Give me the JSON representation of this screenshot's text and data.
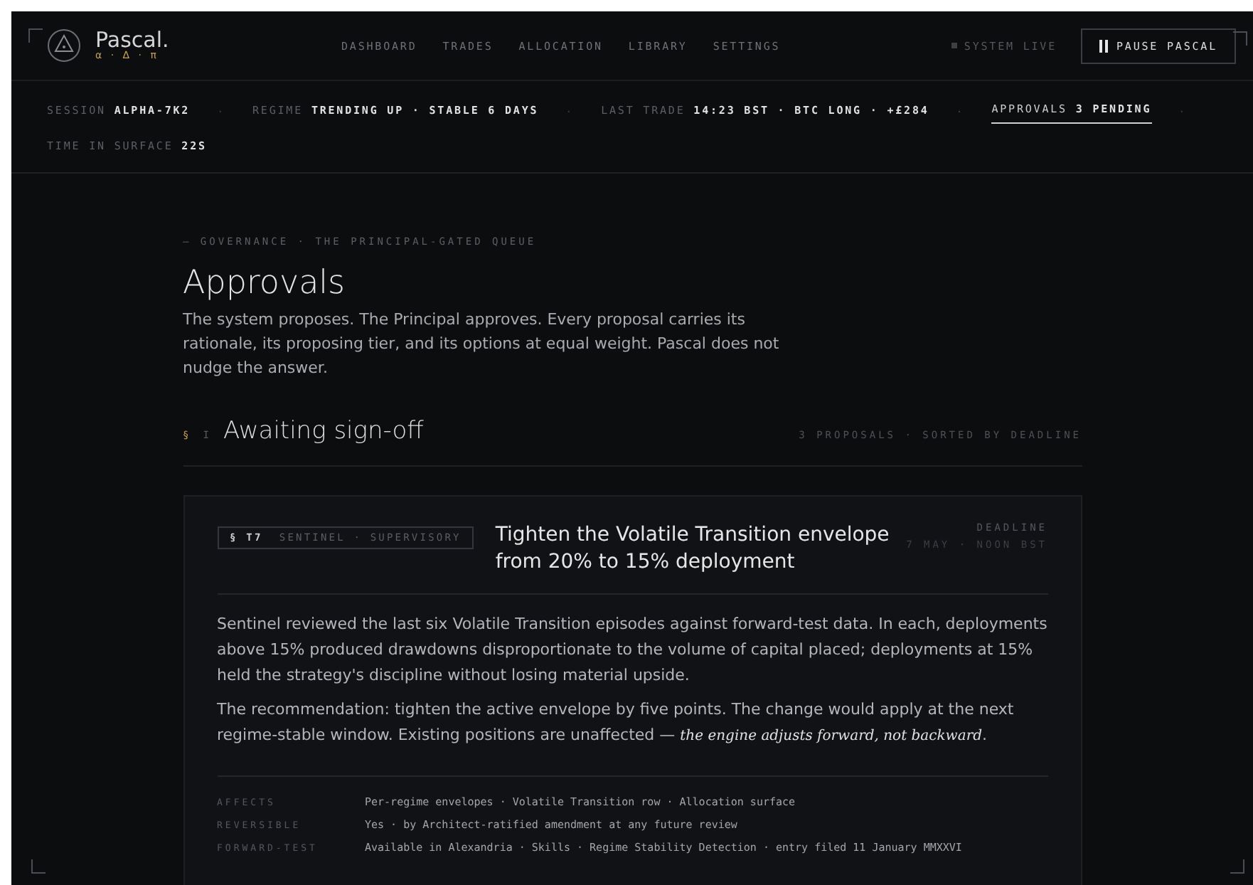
{
  "brand": {
    "name": "Pascal.",
    "subtitle": "α · Δ · π"
  },
  "nav": [
    "DASHBOARD",
    "TRADES",
    "ALLOCATION",
    "LIBRARY",
    "SETTINGS"
  ],
  "system_status": "SYSTEM LIVE",
  "pause_button": "PAUSE PASCAL",
  "ticker_separator": "·",
  "ticker": [
    {
      "label": "SESSION",
      "value": "ALPHA-7K2",
      "selected": false
    },
    {
      "label": "REGIME",
      "value": "TRENDING UP · STABLE 6 DAYS",
      "selected": false
    },
    {
      "label": "LAST TRADE",
      "value": "14:23 BST · BTC LONG · +£284",
      "selected": false
    },
    {
      "label": "APPROVALS",
      "value": "3 PENDING",
      "selected": true
    },
    {
      "label": "TIME IN SURFACE",
      "value": "22S",
      "selected": false
    }
  ],
  "header": {
    "eyebrow": "— GOVERNANCE · THE PRINCIPAL-GATED QUEUE",
    "title": "Approvals",
    "lead": "The system proposes. The Principal approves. Every proposal carries its rationale, its proposing tier, and its options at equal weight. Pascal does not nudge the answer."
  },
  "section": {
    "marker": "§",
    "numeral": "I",
    "title": "Awaiting sign-off",
    "meta": "3 PROPOSALS · SORTED BY DEADLINE"
  },
  "proposal": {
    "tag": "§ T7",
    "tier": "SENTINEL · SUPERVISORY",
    "title": "Tighten the Volatile Transition envelope from 20% to 15% deployment",
    "deadline_label": "DEADLINE",
    "deadline": "7 MAY · NOON BST",
    "paragraphs": [
      "Sentinel reviewed the last six Volatile Transition episodes against forward-test data. In each, deployments above 15% produced drawdowns disproportionate to the volume of capital placed; deployments at 15% held the strategy's discipline without losing material upside.",
      "The recommendation: tighten the active envelope by five points. The change would apply at the next regime-stable window. Existing positions are unaffected — *the engine adjusts forward, not backward*."
    ],
    "details": [
      {
        "label": "AFFECTS",
        "value": "Per-regime envelopes · Volatile Transition row · Allocation surface"
      },
      {
        "label": "REVERSIBLE",
        "value": "Yes · by Architect-ratified amendment at any future review"
      },
      {
        "label": "FORWARD-TEST",
        "value": "Available in Alexandria · Skills · Regime Stability Detection · entry filed 11 January MMXXVI"
      }
    ]
  }
}
